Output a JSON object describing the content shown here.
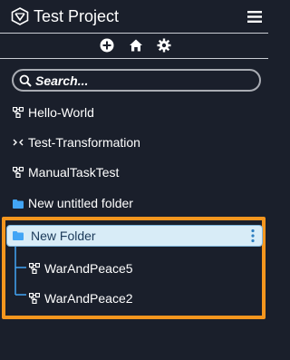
{
  "header": {
    "title": "Test Project",
    "logo_icon": "project-logo-icon",
    "menu_icon": "hamburger-menu-icon"
  },
  "toolbar": {
    "add_icon": "add-circle-icon",
    "home_icon": "home-icon",
    "settings_icon": "gear-icon"
  },
  "search": {
    "placeholder": "Search..."
  },
  "tree": {
    "items": [
      {
        "label": "Hello-World",
        "icon": "workflow-icon"
      },
      {
        "label": "Test-Transformation",
        "icon": "transformation-icon"
      },
      {
        "label": "ManualTaskTest",
        "icon": "workflow-icon"
      },
      {
        "label": "New untitled folder",
        "icon": "folder-icon"
      }
    ],
    "selected_folder": {
      "label": "New Folder",
      "icon": "folder-icon",
      "children": [
        {
          "label": "WarAndPeace5",
          "icon": "workflow-icon"
        },
        {
          "label": "WarAndPeace2",
          "icon": "workflow-icon"
        }
      ]
    }
  },
  "colors": {
    "background": "#1a1f2b",
    "accent_highlight": "#f5961e",
    "folder": "#42a5f5",
    "selected_row": "#d8ecf7"
  }
}
